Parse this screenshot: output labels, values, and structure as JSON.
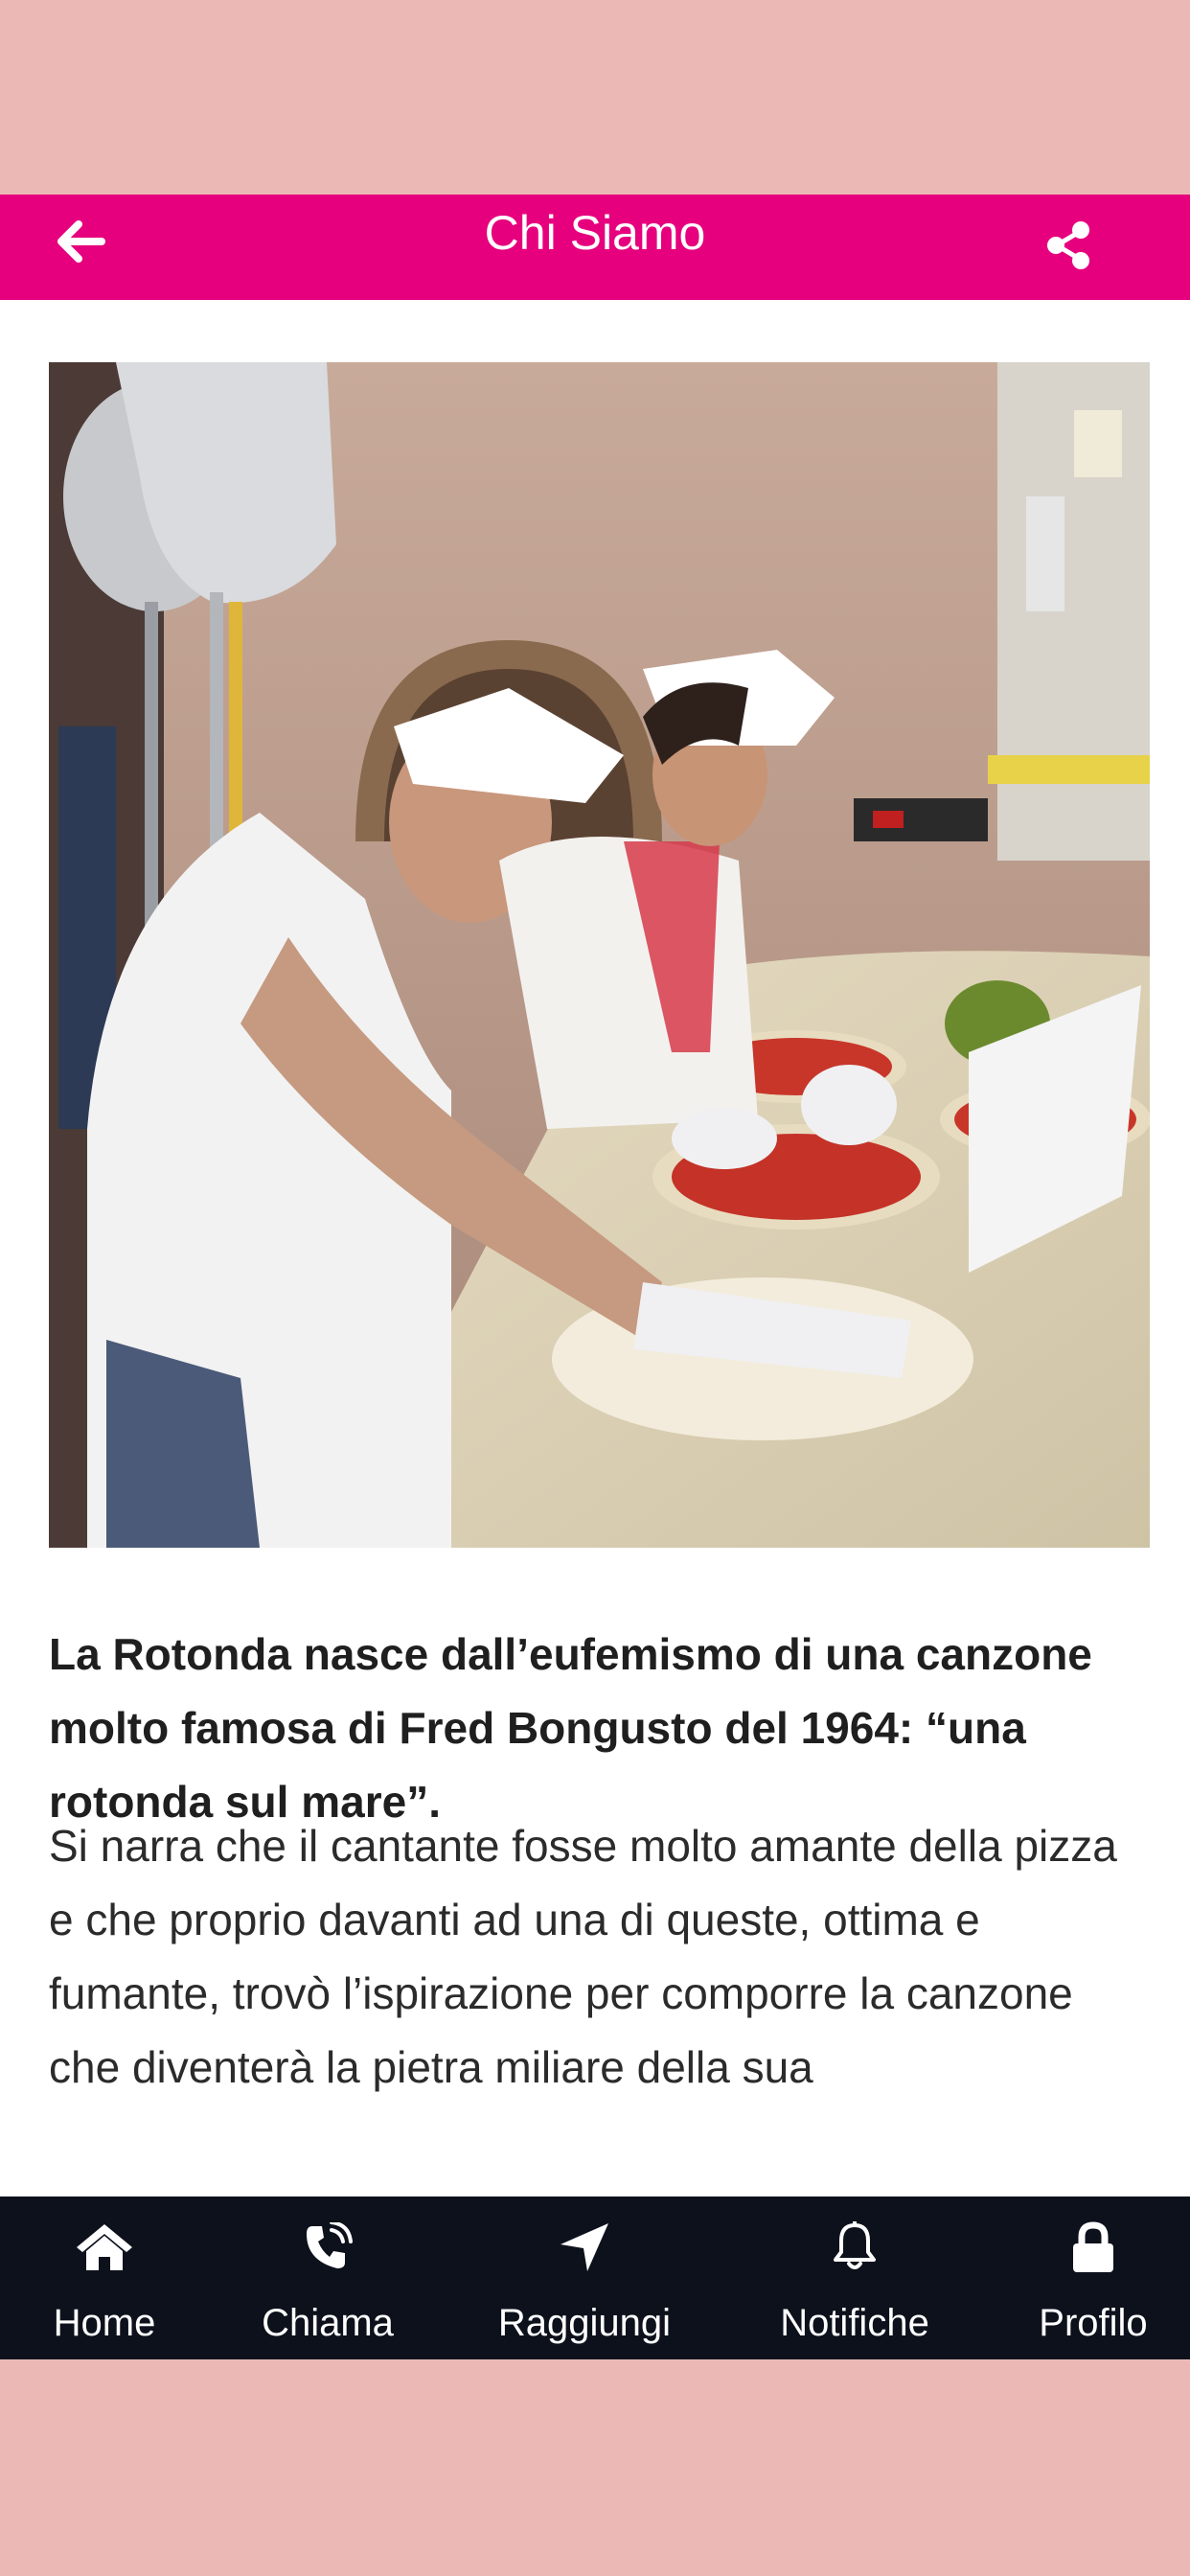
{
  "header": {
    "title": "Chi Siamo",
    "back_icon": "arrow-left-icon",
    "share_icon": "share-icon"
  },
  "content": {
    "photo_description": "pizza-makers-photo",
    "intro": "La Rotonda nasce dall’eufemismo di una canzone molto famosa di Fred Bongusto del 1964: “una rotonda sul mare”.",
    "body": "Si narra che il cantante fosse molto amante della pizza e che proprio davanti ad una di queste, ottima e fumante, trovò l’ispirazione per comporre la canzone che diventerà la pietra miliare della sua"
  },
  "tabbar": {
    "items": [
      {
        "label": "Home",
        "icon": "home-icon"
      },
      {
        "label": "Chiama",
        "icon": "phone-icon"
      },
      {
        "label": "Raggiungi",
        "icon": "location-arrow-icon"
      },
      {
        "label": "Notifiche",
        "icon": "bell-icon"
      },
      {
        "label": "Profilo",
        "icon": "lock-icon"
      }
    ]
  },
  "colors": {
    "header": "#e6007e",
    "tabbar": "#0c111c",
    "outer_background": "#ebb8b6"
  }
}
